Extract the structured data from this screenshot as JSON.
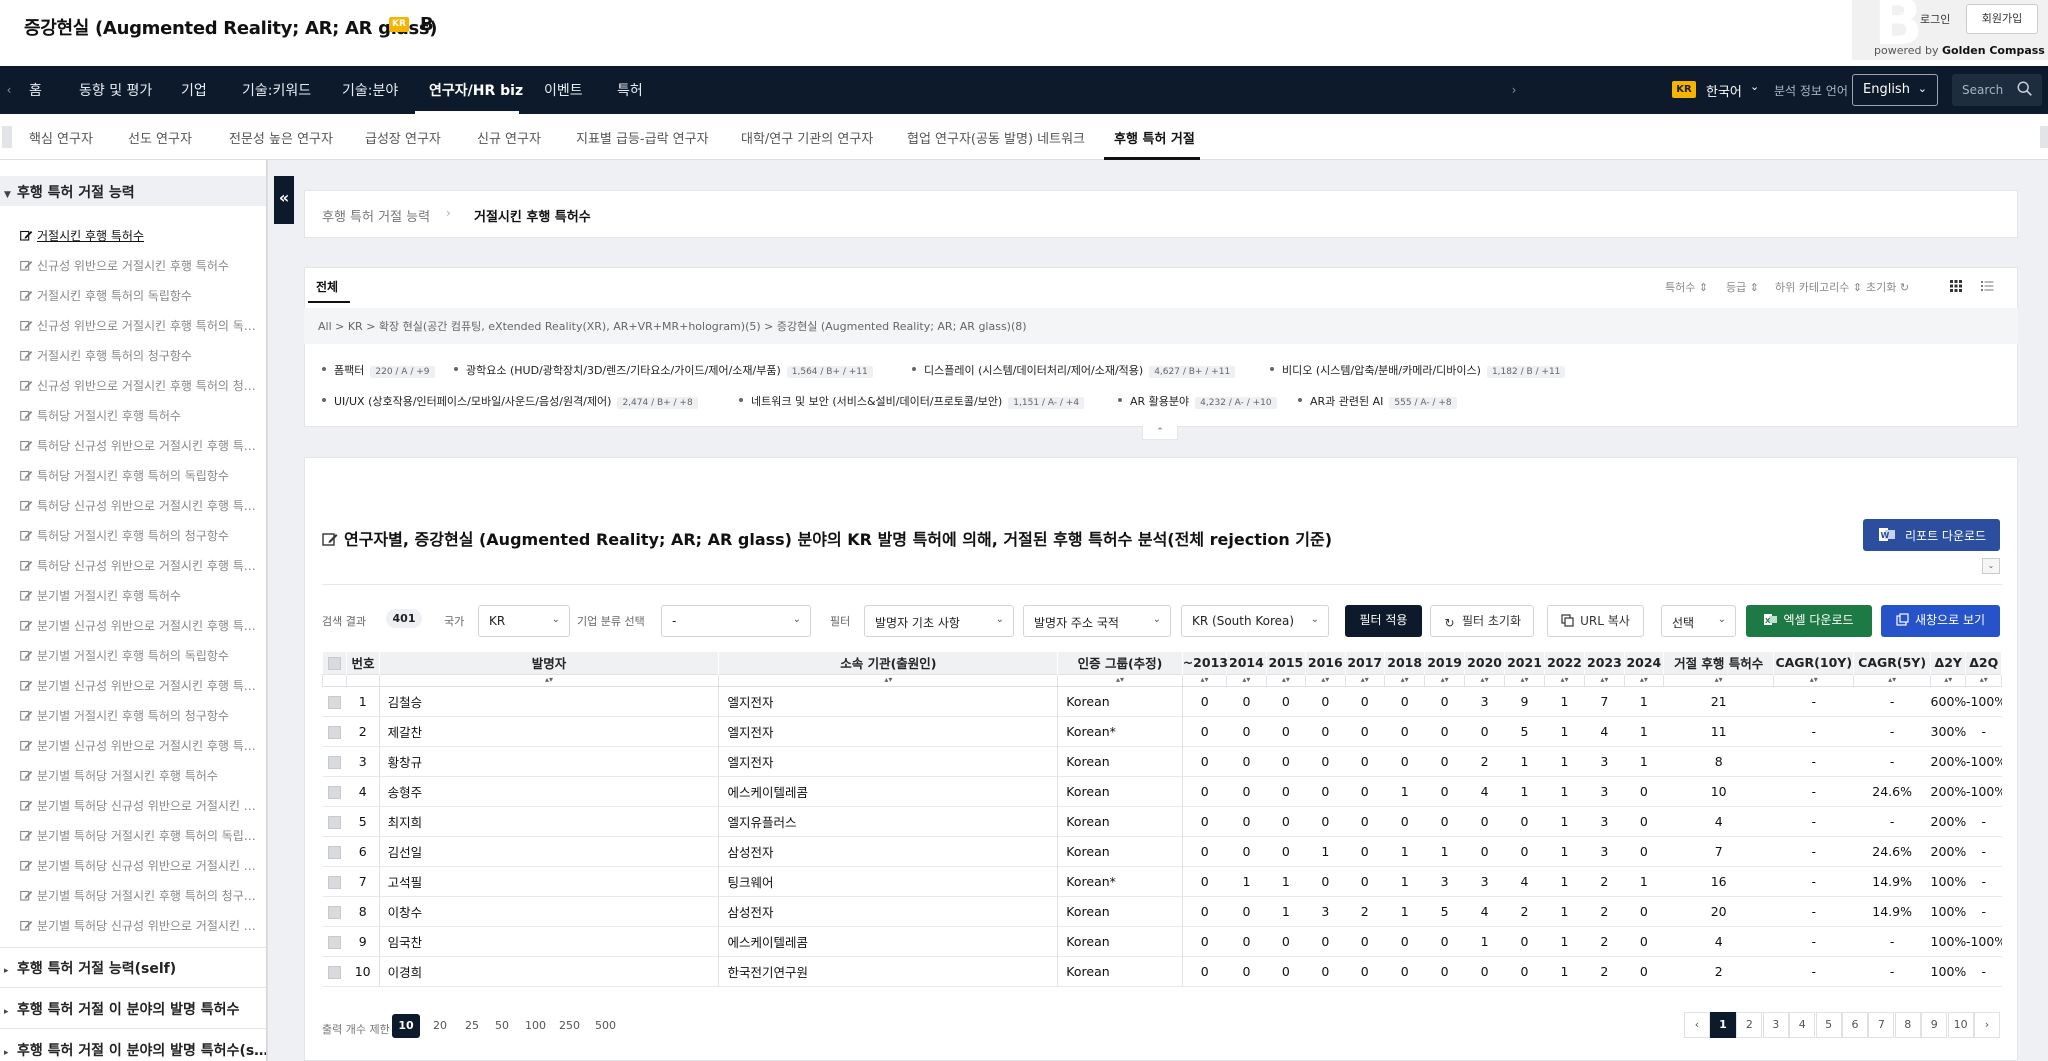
{
  "header": {
    "title": "증강현실 (Augmented Reality; AR; AR glass)",
    "lang_badge": "KR",
    "grade": "B",
    "login": "로그인",
    "signup": "회원가입",
    "powered_by": "powered by",
    "brand": "Golden Compass"
  },
  "nav": {
    "items": [
      "홈",
      "동향 및 평가",
      "기업",
      "기술:키워드",
      "기술:분야",
      "연구자/HR biz",
      "이벤트",
      "특허"
    ],
    "active_index": 5,
    "kr_badge": "KR",
    "language": "한국어",
    "analysis_lang_label": "분석 정보 언어",
    "analysis_lang_value": "English",
    "search_placeholder": "Search"
  },
  "subnav": {
    "items": [
      "핵심 연구자",
      "선도 연구자",
      "전문성 높은 연구자",
      "급성장 연구자",
      "신규 연구자",
      "지표별 급등-급락 연구자",
      "대학/연구 기관의 연구자",
      "협업 연구자(공동 발명) 네트워크",
      "후행 특허 거절"
    ],
    "active_index": 8
  },
  "sidebar": {
    "group_title": "후행 특허 거절 능력",
    "items": [
      "거절시킨 후행 특허수",
      "신규성 위반으로 거절시킨 후행 특허수",
      "거절시킨 후행 특허의 독립항수",
      "신규성 위반으로 거절시킨 후행 특허의 독…",
      "거절시킨 후행 특허의 청구항수",
      "신규성 위반으로 거절시킨 후행 특허의 청…",
      "특허당 거절시킨 후행 특허수",
      "특허당 신규성 위반으로 거절시킨 후행 특…",
      "특허당 거절시킨 후행 특허의 독립항수",
      "특허당 신규성 위반으로 거절시킨 후행 특…",
      "특허당 거절시킨 후행 특허의 청구항수",
      "특허당 신규성 위반으로 거절시킨 후행 특…",
      "분기별 거절시킨 후행 특허수",
      "분기별 신규성 위반으로 거절시킨 후행 특…",
      "분기별 거절시킨 후행 특허의 독립항수",
      "분기별 신규성 위반으로 거절시킨 후행 특…",
      "분기별 거절시킨 후행 특허의 청구항수",
      "분기별 신규성 위반으로 거절시킨 후행 특…",
      "분기별 특허당 거절시킨 후행 특허수",
      "분기별 특허당 신규성 위반으로 거절시킨 …",
      "분기별 특허당 거절시킨 후행 특허의 독립…",
      "분기별 특허당 신규성 위반으로 거절시킨 …",
      "분기별 특허당 거절시킨 후행 특허의 청구…",
      "분기별 특허당 신규성 위반으로 거절시킨 …"
    ],
    "active_index": 0,
    "other_groups": [
      "후행 특허 거절 능력(self)",
      "후행 특허 거절 이 분야의 발명 특허수",
      "후행 특허 거절 이 분야의 발명 특허수(s…"
    ]
  },
  "breadcrumb": {
    "parent": "후행 특허 거절 능력",
    "current": "거절시킨 후행 특허수"
  },
  "category": {
    "tab": "전체",
    "sort_labels": [
      "특허수",
      "등급",
      "하위 카테고리수",
      "초기화"
    ],
    "path": "All  >  KR  >  확장 현실(공간 컴퓨팅, eXtended Reality(XR), AR+VR+MR+hologram)(5)  >  증강현실 (Augmented Reality; AR; AR glass)(8)",
    "chips": [
      {
        "name": "폼팩터",
        "meta": "220 / A / +9"
      },
      {
        "name": "광학요소 (HUD/광학장치/3D/렌즈/기타요소/가이드/제어/소재/부품)",
        "meta": "1,564 / B+ / +11"
      },
      {
        "name": "디스플레이 (시스템/데이터처리/제어/소재/적용)",
        "meta": "4,627 / B+ / +11"
      },
      {
        "name": "비디오 (시스템/압축/분배/카메라/디바이스)",
        "meta": "1,182 / B / +11"
      },
      {
        "name": "UI/UX (상호작용/인터페이스/모바일/사운드/음성/원격/제어)",
        "meta": "2,474 / B+ / +8"
      },
      {
        "name": "네트워크 및 보안 (서비스&설비/데이터/프로토콜/보안)",
        "meta": "1,151 / A- / +4"
      },
      {
        "name": "AR 활용분야",
        "meta": "4,232 / A- / +10"
      },
      {
        "name": "AR과 관련된 AI",
        "meta": "555 / A- / +8"
      }
    ]
  },
  "analysis": {
    "title": "연구자별, 증강현실 (Augmented Reality; AR; AR glass) 분야의 KR 발명 특허에 의해, 거절된 후행 특허수 분석(전체 rejection 기준)",
    "report_button": "리포트 다운로드",
    "filters": {
      "result_label": "검색 결과",
      "result_count": "401",
      "country_label": "국가",
      "country_value": "KR",
      "company_class_label": "기업 분류 선택",
      "company_class_value": "-",
      "filter_label": "필터",
      "inventor_basic": "발명자 기초 사항",
      "inventor_country": "발명자 주소 국적",
      "country_select": "KR (South Korea)",
      "apply": "필터 적용",
      "reset": "필터 초기화",
      "copy_url": "URL 복사",
      "choose": "선택",
      "excel": "엑셀 다운로드",
      "new_window": "새창으로 보기"
    },
    "columns": [
      "번호",
      "발명자",
      "소속 기관(출원인)",
      "인증 그룹(추정)",
      "~2013",
      "2014",
      "2015",
      "2016",
      "2017",
      "2018",
      "2019",
      "2020",
      "2021",
      "2022",
      "2023",
      "2024",
      "거절 후행 특허수",
      "CAGR(10Y)",
      "CAGR(5Y)",
      "Δ2Y",
      "Δ2Q"
    ],
    "rows": [
      [
        "1",
        "김철승",
        "엘지전자",
        "Korean",
        "0",
        "0",
        "0",
        "0",
        "0",
        "0",
        "0",
        "3",
        "9",
        "1",
        "7",
        "1",
        "21",
        "-",
        "-",
        "600%",
        "-100%"
      ],
      [
        "2",
        "제갈찬",
        "엘지전자",
        "Korean*",
        "0",
        "0",
        "0",
        "0",
        "0",
        "0",
        "0",
        "0",
        "5",
        "1",
        "4",
        "1",
        "11",
        "-",
        "-",
        "300%",
        "-"
      ],
      [
        "3",
        "황창규",
        "엘지전자",
        "Korean",
        "0",
        "0",
        "0",
        "0",
        "0",
        "0",
        "0",
        "2",
        "1",
        "1",
        "3",
        "1",
        "8",
        "-",
        "-",
        "200%",
        "-100%"
      ],
      [
        "4",
        "송형주",
        "에스케이텔레콤",
        "Korean",
        "0",
        "0",
        "0",
        "0",
        "0",
        "1",
        "0",
        "4",
        "1",
        "1",
        "3",
        "0",
        "10",
        "-",
        "24.6%",
        "200%",
        "-100%"
      ],
      [
        "5",
        "최지희",
        "엘지유플러스",
        "Korean",
        "0",
        "0",
        "0",
        "0",
        "0",
        "0",
        "0",
        "0",
        "0",
        "1",
        "3",
        "0",
        "4",
        "-",
        "-",
        "200%",
        "-"
      ],
      [
        "6",
        "김선일",
        "삼성전자",
        "Korean",
        "0",
        "0",
        "0",
        "1",
        "0",
        "1",
        "1",
        "0",
        "0",
        "1",
        "3",
        "0",
        "7",
        "-",
        "24.6%",
        "200%",
        "-"
      ],
      [
        "7",
        "고석필",
        "팅크웨어",
        "Korean*",
        "0",
        "1",
        "1",
        "0",
        "0",
        "1",
        "3",
        "3",
        "4",
        "1",
        "2",
        "1",
        "16",
        "-",
        "14.9%",
        "100%",
        "-"
      ],
      [
        "8",
        "이창수",
        "삼성전자",
        "Korean",
        "0",
        "0",
        "1",
        "3",
        "2",
        "1",
        "5",
        "4",
        "2",
        "1",
        "2",
        "0",
        "20",
        "-",
        "14.9%",
        "100%",
        "-"
      ],
      [
        "9",
        "임국찬",
        "에스케이텔레콤",
        "Korean",
        "0",
        "0",
        "0",
        "0",
        "0",
        "0",
        "0",
        "1",
        "0",
        "1",
        "2",
        "0",
        "4",
        "-",
        "-",
        "100%",
        "-100%"
      ],
      [
        "10",
        "이경희",
        "한국전기연구원",
        "Korean",
        "0",
        "0",
        "0",
        "0",
        "0",
        "0",
        "0",
        "0",
        "0",
        "1",
        "2",
        "0",
        "2",
        "-",
        "-",
        "100%",
        "-"
      ]
    ],
    "per_page_label": "출력 개수 제한",
    "per_page_options": [
      "10",
      "20",
      "25",
      "50",
      "100",
      "250",
      "500"
    ],
    "per_page_active": "10",
    "pages": [
      "1",
      "2",
      "3",
      "4",
      "5",
      "6",
      "7",
      "8",
      "9",
      "10"
    ],
    "current_page": "1"
  }
}
